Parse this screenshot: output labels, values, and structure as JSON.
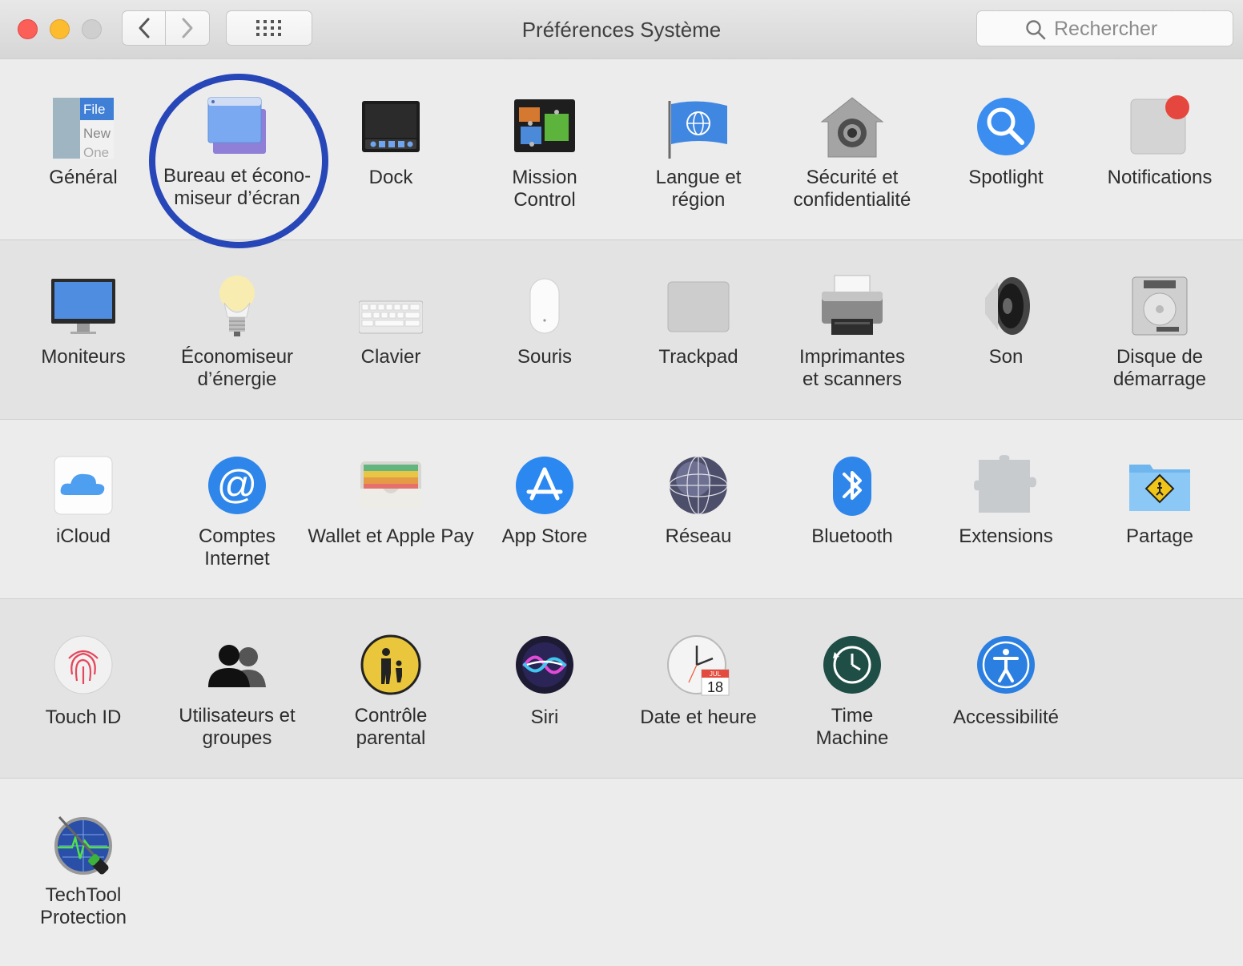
{
  "window": {
    "title": "Préférences Système"
  },
  "search": {
    "placeholder": "Rechercher"
  },
  "rows": [
    [
      "Général",
      "Bureau et écono-\nmiseur d’écran",
      "Dock",
      "Mission\nControl",
      "Langue et\nrégion",
      "Sécurité et\nconfidentialité",
      "Spotlight",
      "Notifications"
    ],
    [
      "Moniteurs",
      "Économiseur\nd’énergie",
      "Clavier",
      "Souris",
      "Trackpad",
      "Imprimantes\net scanners",
      "Son",
      "Disque de\ndémarrage"
    ],
    [
      "iCloud",
      "Comptes\nInternet",
      "Wallet et Apple Pay",
      "App Store",
      "Réseau",
      "Bluetooth",
      "Extensions",
      "Partage"
    ],
    [
      "Touch ID",
      "Utilisateurs et\ngroupes",
      "Contrôle\nparental",
      "Siri",
      "Date et heure",
      "Time\nMachine",
      "Accessibilité"
    ],
    [
      "TechTool\nProtection"
    ]
  ],
  "icon_text": {
    "general": [
      "File",
      "New",
      "One"
    ],
    "calendar_month": "JUL",
    "calendar_day": "18"
  },
  "highlight": "Bureau et écono-\nmiseur d’écran"
}
